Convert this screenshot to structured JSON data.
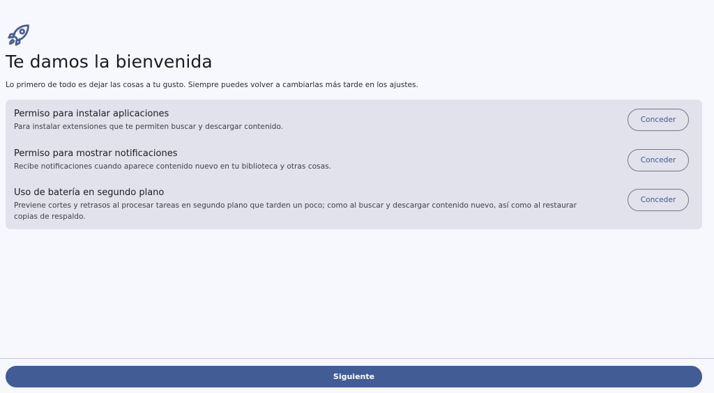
{
  "header": {
    "icon": "rocket-icon",
    "title": "Te damos la bienvenida",
    "subtitle": "Lo primero de todo es dejar las cosas a tu gusto. Siempre puedes volver a cambiarlas más tarde en los ajustes."
  },
  "permissions": [
    {
      "title": "Permiso para instalar aplicaciones",
      "description": "Para instalar extensiones que te permiten buscar y descargar contenido.",
      "button_label": "Conceder"
    },
    {
      "title": "Permiso para mostrar notificaciones",
      "description": "Recibe notificaciones cuando aparece contenido nuevo en tu biblioteca y otras cosas.",
      "button_label": "Conceder"
    },
    {
      "title": "Uso de batería en segundo plano",
      "description": "Previene cortes y retrasos al procesar tareas en segundo plano que tarden un poco; como al buscar y descargar contenido nuevo, así como al restaurar copias de respaldo.",
      "button_label": "Conceder"
    }
  ],
  "footer": {
    "next_label": "Siguiente"
  },
  "colors": {
    "background": "#f7f8fd",
    "card": "#e2e2ec",
    "accent": "#425c96",
    "button_text": "#3f5a93"
  }
}
